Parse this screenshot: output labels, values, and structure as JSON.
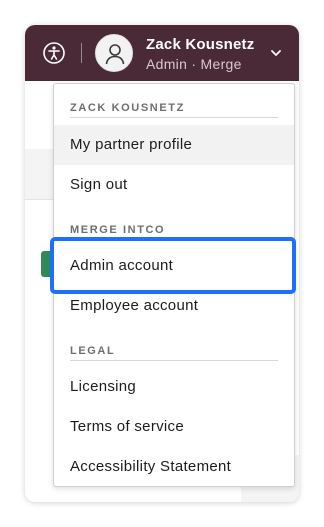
{
  "header": {
    "accessibility_icon": "accessibility-icon",
    "user": {
      "name": "Zack Kousnetz",
      "role": "Admin · Merge",
      "avatar_icon": "user-icon"
    },
    "menu_toggle_icon": "chevron-down-icon"
  },
  "menu": {
    "sections": [
      {
        "label": "ZACK KOUSNETZ",
        "items": [
          {
            "label": "My partner profile"
          },
          {
            "label": "Sign out"
          }
        ]
      },
      {
        "label": "MERGE INTCO",
        "items": [
          {
            "label": "Admin account"
          },
          {
            "label": "Employee account"
          }
        ]
      },
      {
        "label": "LEGAL",
        "items": [
          {
            "label": "Licensing"
          },
          {
            "label": "Terms of service"
          },
          {
            "label": "Accessibility Statement"
          }
        ]
      }
    ],
    "focused_item": "Admin account",
    "hovered_item": "My partner profile"
  },
  "colors": {
    "topbar": "#4a2a36",
    "focus_ring": "#1f6fff",
    "hover_bg": "#f2f2f2"
  }
}
